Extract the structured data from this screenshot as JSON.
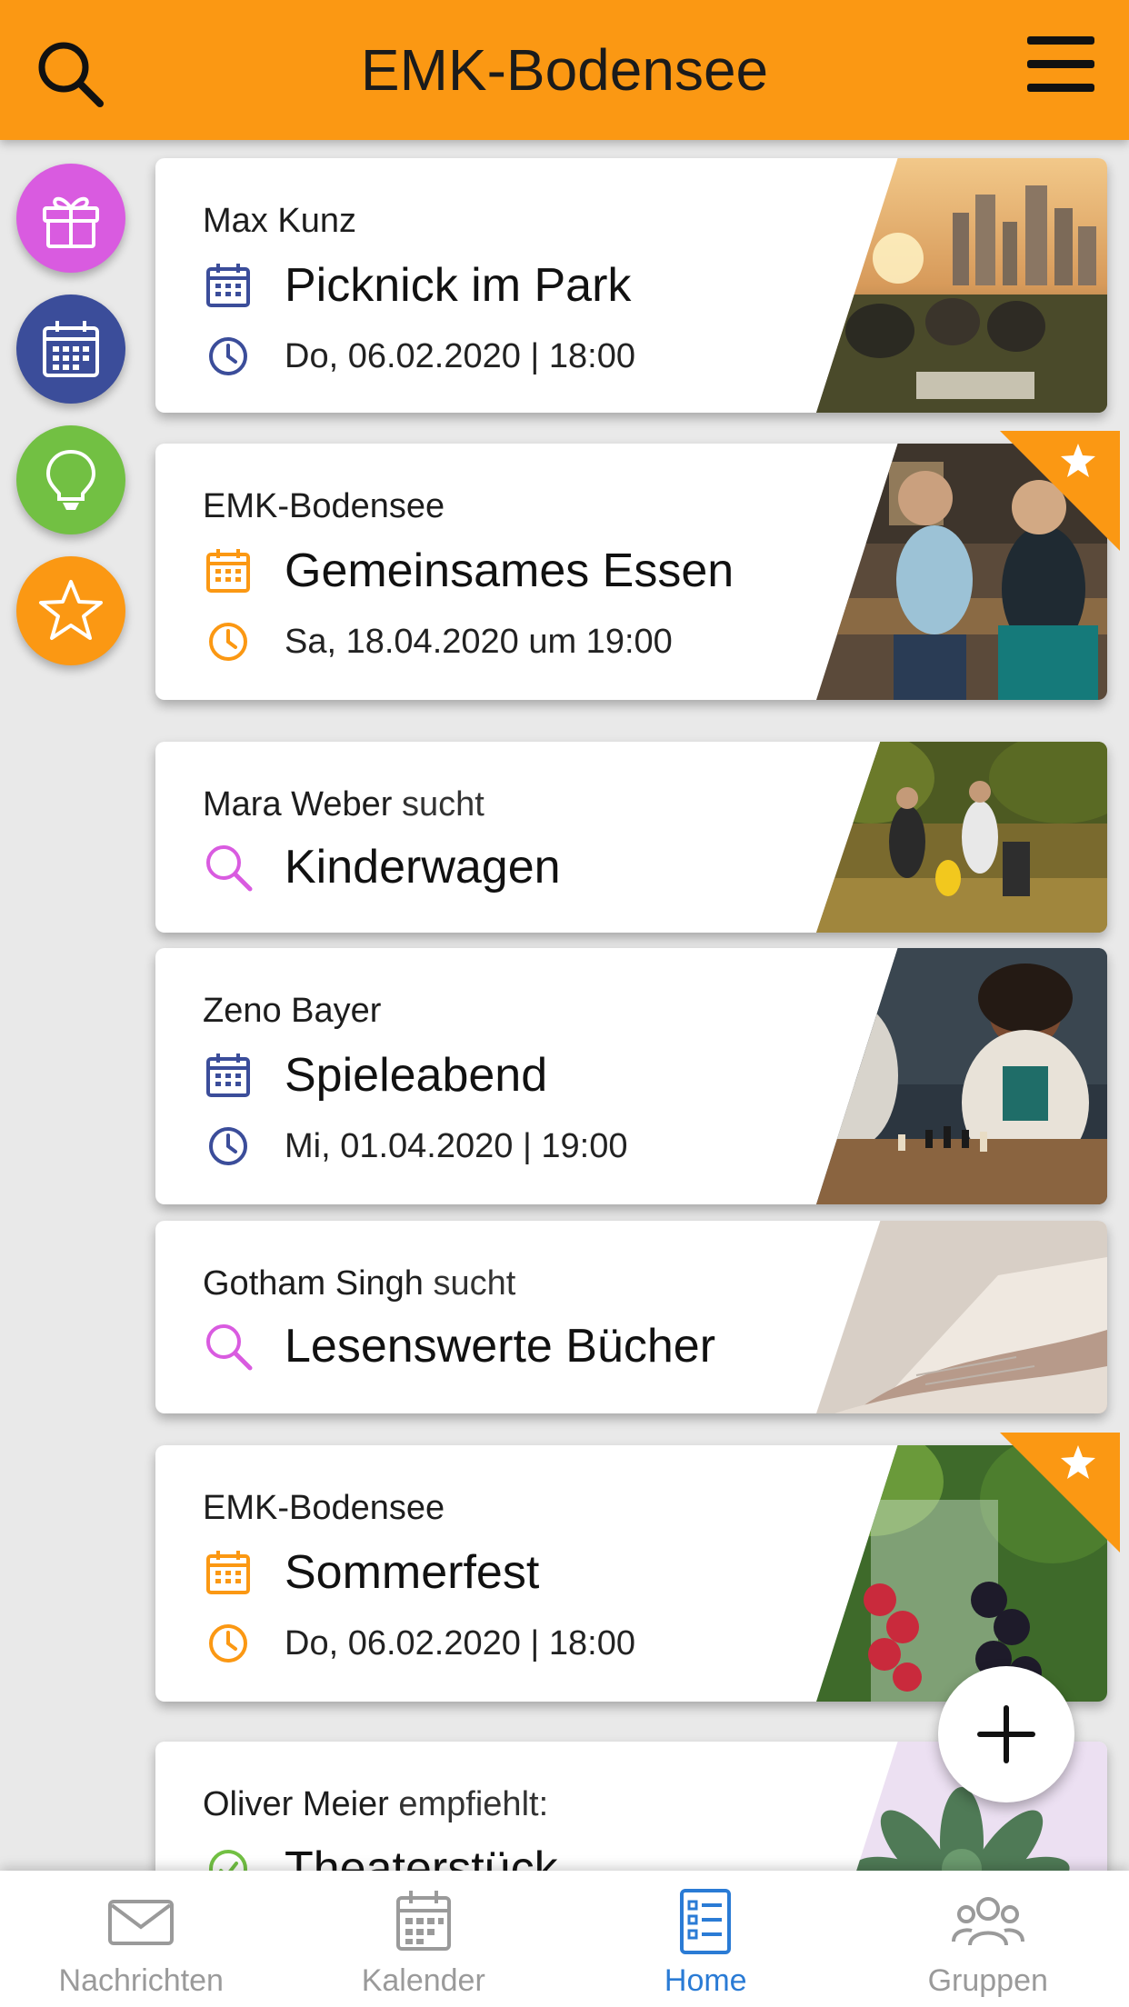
{
  "header": {
    "title": "EMK-Bodensee",
    "search_icon": "search-icon",
    "menu_icon": "hamburger-menu-icon"
  },
  "side_filters": [
    {
      "name": "gift",
      "icon": "gift-icon",
      "color": "#d95be0"
    },
    {
      "name": "calendar",
      "icon": "calendar-icon",
      "color": "#3b4d9a"
    },
    {
      "name": "idea",
      "icon": "lightbulb-icon",
      "color": "#72c043"
    },
    {
      "name": "favorites",
      "icon": "star-icon",
      "color": "#fb9813"
    }
  ],
  "cards": [
    {
      "author": "Max Kunz",
      "suffix": "",
      "title": "Picknick im Park",
      "date": "Do, 06.02.2020 | 18:00",
      "type": "event",
      "accent": "#3b4d9a",
      "featured": false,
      "image": "picnic-photo"
    },
    {
      "author": "EMK-Bodensee",
      "suffix": "",
      "title": "Gemeinsames Essen",
      "date": "Sa, 18.04.2020 um 19:00",
      "type": "event",
      "accent": "#fb9813",
      "featured": true,
      "image": "friends-drinks-photo"
    },
    {
      "author": "Mara Weber",
      "suffix": "sucht",
      "title": "Kinderwagen",
      "date": "",
      "type": "search",
      "accent": "#d95be0",
      "featured": false,
      "image": "family-park-photo"
    },
    {
      "author": "Zeno Bayer",
      "suffix": "",
      "title": "Spieleabend",
      "date": "Mi, 01.04.2020 | 19:00",
      "type": "event",
      "accent": "#3b4d9a",
      "featured": false,
      "image": "chess-photo"
    },
    {
      "author": "Gotham Singh",
      "suffix": "sucht",
      "title": "Lesenswerte Bücher",
      "date": "",
      "type": "search",
      "accent": "#d95be0",
      "featured": false,
      "image": "book-pages-photo"
    },
    {
      "author": "EMK-Bodensee",
      "suffix": "",
      "title": "Sommerfest",
      "date": "Do, 06.02.2020 | 18:00",
      "type": "event",
      "accent": "#fb9813",
      "featured": true,
      "image": "berries-drink-photo"
    },
    {
      "author": "Oliver Meier",
      "suffix": "empfiehlt:",
      "title": "Theaterstück",
      "date": "",
      "type": "recommendation",
      "accent": "#72c043",
      "featured": false,
      "image": "succulent-photo"
    }
  ],
  "fab": {
    "icon": "plus-icon"
  },
  "bottom_nav": [
    {
      "label": "Nachrichten",
      "icon": "envelope-icon",
      "active": false
    },
    {
      "label": "Kalender",
      "icon": "calendar-icon",
      "active": false
    },
    {
      "label": "Home",
      "icon": "list-icon",
      "active": true
    },
    {
      "label": "Gruppen",
      "icon": "group-icon",
      "active": false
    }
  ],
  "colors": {
    "header": "#fb9813",
    "active_nav": "#2a7bd5",
    "inactive_nav": "#9a9a9a"
  }
}
